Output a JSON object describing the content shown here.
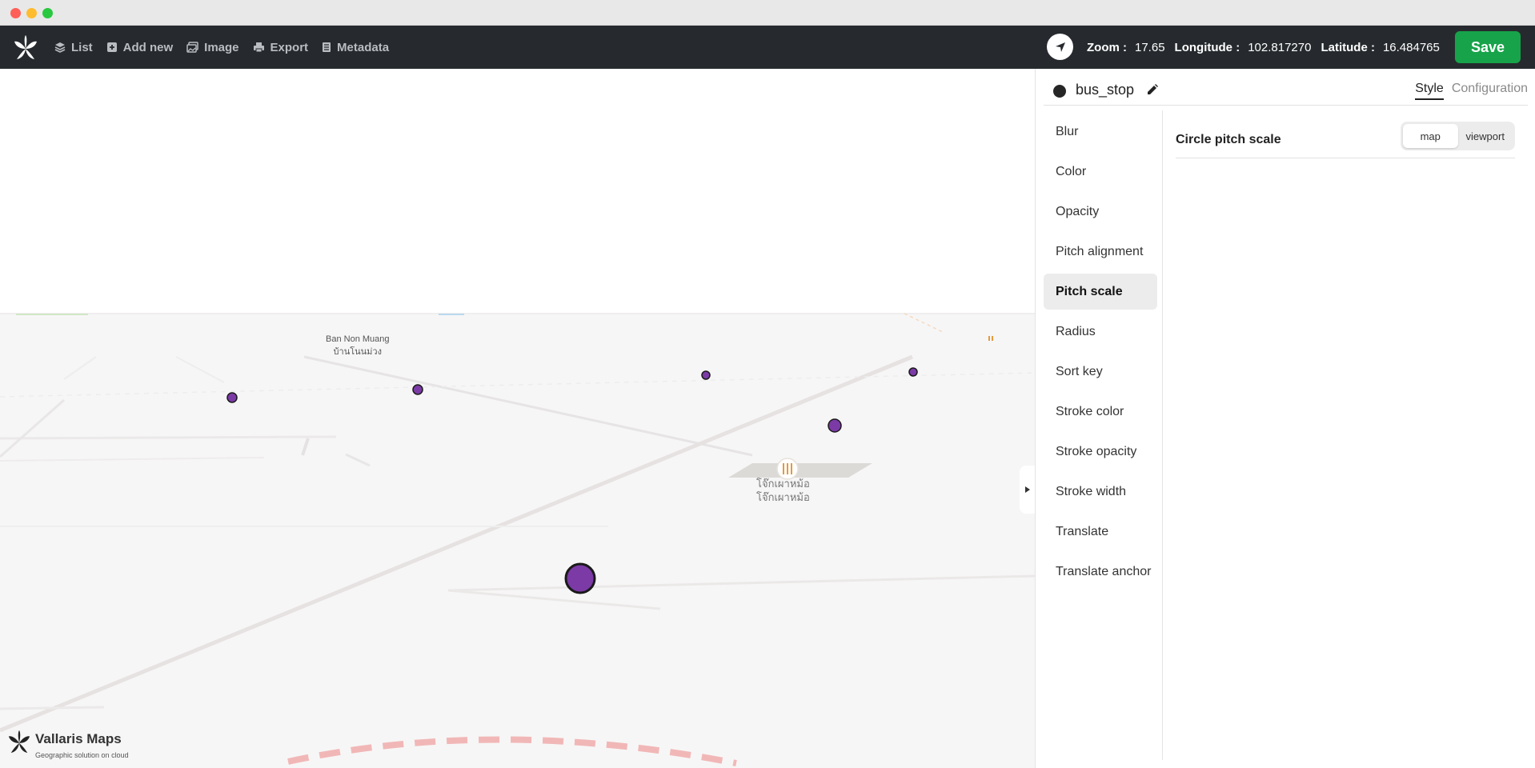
{
  "toolbar": {
    "nav": [
      {
        "label": "List",
        "icon": "layers-icon"
      },
      {
        "label": "Add new",
        "icon": "plus-square-icon"
      },
      {
        "label": "Image",
        "icon": "image-icon"
      },
      {
        "label": "Export",
        "icon": "printer-icon"
      },
      {
        "label": "Metadata",
        "icon": "document-icon"
      }
    ],
    "zoom_label": "Zoom :",
    "zoom_value": "17.65",
    "longitude_label": "Longitude :",
    "longitude_value": "102.817270",
    "latitude_label": "Latitude :",
    "latitude_value": "16.484765",
    "save_label": "Save",
    "colors": {
      "bar": "#262a2e",
      "save": "#17a34a"
    }
  },
  "map": {
    "village_label_en": "Ban Non Muang",
    "village_label_th": "บ้านโนนม่วง",
    "poi_label_line1": "โจ๊กเผาหม้อ",
    "poi_label_line2": "โจ๊กเผาหม้อ",
    "stop_color": "#7b3aa6",
    "brand_name": "Vallaris Maps",
    "brand_tagline": "Geographic solution on cloud"
  },
  "panel": {
    "layer_name": "bus_stop",
    "tabs": [
      "Style",
      "Configuration"
    ],
    "active_tab": "Style",
    "properties": [
      "Blur",
      "Color",
      "Opacity",
      "Pitch alignment",
      "Pitch scale",
      "Radius",
      "Sort key",
      "Stroke color",
      "Stroke opacity",
      "Stroke width",
      "Translate",
      "Translate anchor"
    ],
    "active_property": "Pitch scale",
    "setting_label": "Circle pitch scale",
    "options": [
      "map",
      "viewport"
    ],
    "selected_option": "map"
  }
}
